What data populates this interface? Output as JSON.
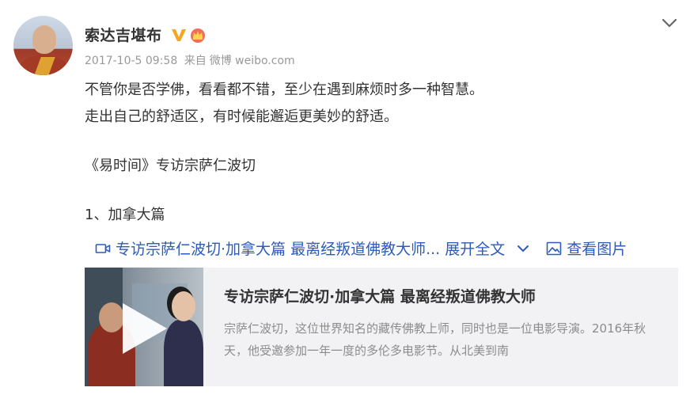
{
  "post": {
    "user": {
      "name": "索达吉堪布",
      "badges": [
        "vip-v-icon",
        "crown-icon"
      ]
    },
    "meta": {
      "timestamp": "2017-10-5 09:58",
      "source_prefix": "来自",
      "source": "微博 weibo.com"
    },
    "text": {
      "line1": "不管你是否学佛，看看都不错，至少在遇到麻烦时多一种智慧。",
      "line2": "走出自己的舒适区，有时候能邂逅更美妙的舒适。",
      "line3": "《易时间》专访宗萨仁波切",
      "line4": "1、加拿大篇"
    },
    "links": {
      "video_link": "专访宗萨仁波切·加拿大篇 最离经叛道佛教大师...",
      "expand": "展开全文",
      "view_images": "查看图片"
    },
    "card": {
      "title": "专访宗萨仁波切·加拿大篇 最离经叛道佛教大师",
      "description": "宗萨仁波切，这位世界知名的藏传佛教上师，同时也是一位电影导演。2016年秋天，他受邀参加一年一度的多伦多电影节。从北美到南"
    },
    "colors": {
      "link": "#2c5bbb",
      "meta": "#999999",
      "vip": "#f5a623",
      "card_bg": "#f2f2f5"
    }
  }
}
